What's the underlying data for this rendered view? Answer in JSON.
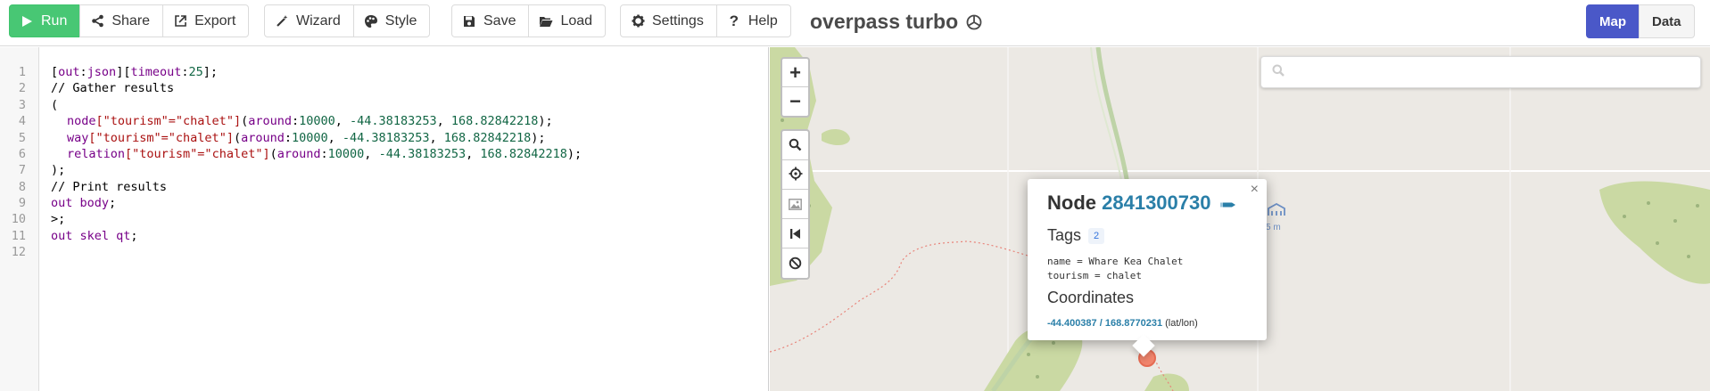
{
  "toolbar": {
    "run": "Run",
    "share": "Share",
    "export": "Export",
    "wizard": "Wizard",
    "style": "Style",
    "save": "Save",
    "load": "Load",
    "settings": "Settings",
    "help": "Help",
    "app_title": "overpass turbo",
    "view_map": "Map",
    "view_data": "Data"
  },
  "editor": {
    "line_numbers": [
      "1",
      "2",
      "3",
      "4",
      "5",
      "6",
      "7",
      "8",
      "9",
      "10",
      "11",
      "12"
    ],
    "lines": {
      "l1": {
        "a": "[",
        "b": "out",
        "c": ":",
        "d": "json",
        "e": "][",
        "f": "timeout",
        "g": ":",
        "h": "25",
        "i": "];"
      },
      "l2": "// Gather results",
      "l3": "(",
      "l4": {
        "kw": "node",
        "s1": "[\"tourism\"=\"chalet\"]",
        "p1": "(",
        "fn": "around",
        "c": ":",
        "n1": "10000",
        "sep1": ", ",
        "n2": "-44.38183253",
        "sep2": ", ",
        "n3": "168.82842218",
        "end": ");"
      },
      "l5": {
        "kw": "way",
        "s1": "[\"tourism\"=\"chalet\"]",
        "p1": "(",
        "fn": "around",
        "c": ":",
        "n1": "10000",
        "sep1": ", ",
        "n2": "-44.38183253",
        "sep2": ", ",
        "n3": "168.82842218",
        "end": ");"
      },
      "l6": {
        "kw": "relation",
        "s1": "[\"tourism\"=\"chalet\"]",
        "p1": "(",
        "fn": "around",
        "c": ":",
        "n1": "10000",
        "sep1": ", ",
        "n2": "-44.38183253",
        "sep2": ", ",
        "n3": "168.82842218",
        "end": ");"
      },
      "l7": ");",
      "l8": "// Print results",
      "l9": {
        "kw": "out body",
        "end": ";"
      },
      "l10": ">;",
      "l11": {
        "kw": "out skel qt",
        "end": ";"
      },
      "l12": ""
    }
  },
  "map": {
    "zoom_in": "+",
    "zoom_out": "−",
    "search_placeholder": "",
    "popup": {
      "title": "Node",
      "node_id": "2841300730",
      "tags_heading": "Tags",
      "tag_count": "2",
      "tag_lines": [
        "name = Whare Kea Chalet",
        "tourism = chalet"
      ],
      "coords_heading": "Coordinates",
      "coords_link": "-44.400387 / 168.8770231",
      "coords_unit": "(lat/lon)",
      "close": "×"
    },
    "hut_label": "5 m"
  },
  "colors": {
    "run_green": "#48c774",
    "map_toggle_blue": "#4a58c8",
    "link_blue": "#2a7fa8",
    "marker": "#f0846c"
  }
}
